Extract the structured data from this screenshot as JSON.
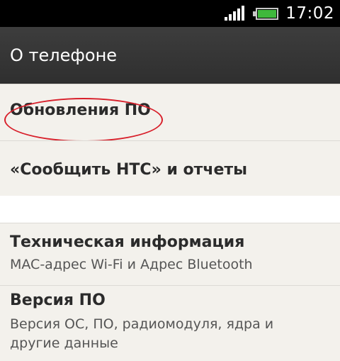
{
  "status_bar": {
    "time": "17:02",
    "icons": [
      "signal-icon",
      "battery-icon"
    ]
  },
  "header": {
    "title": "О телефоне"
  },
  "items": [
    {
      "label": "Обновления ПО"
    },
    {
      "label": "«Сообщить HTC» и отчеты"
    },
    {
      "label": "Техническая информация",
      "subtitle": "MAC-адрес Wi-Fi и Адрес Bluetooth"
    },
    {
      "label": "Версия ПО",
      "subtitle": "Версия ОС, ПО, радиомодуля, ядра и другие данные"
    }
  ],
  "colors": {
    "status_bar": "#000000",
    "title_bar": "#353535",
    "row_background": "#f3f1ec",
    "highlight_circle": "#d81f2a",
    "battery_fill": "#3fb83c"
  }
}
